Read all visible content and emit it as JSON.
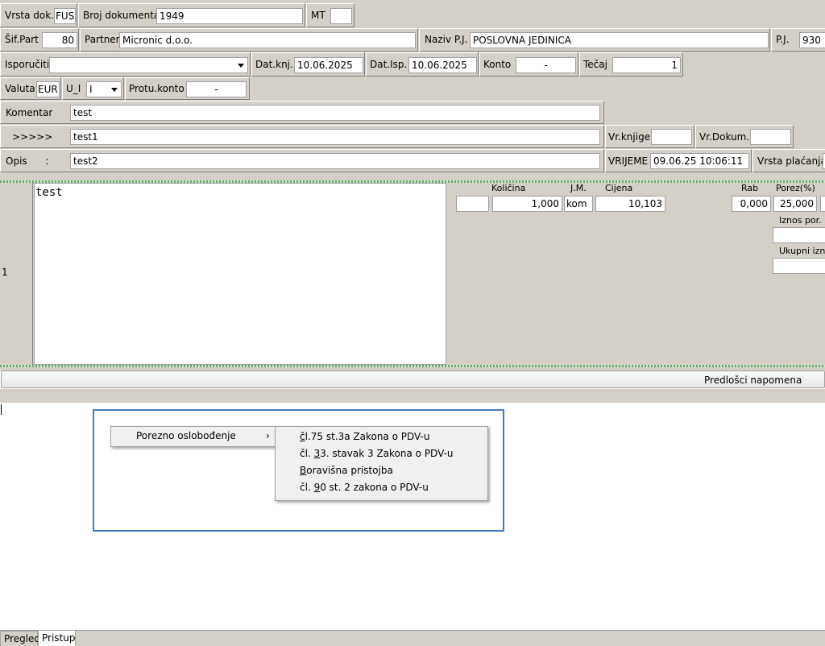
{
  "header": {
    "vrsta_dok_label": "Vrsta dok.",
    "vrsta_dok_value": "FUS",
    "broj_dok_label": "Broj dokumenta",
    "broj_dok_value": "1949",
    "mt_label": "MT",
    "mt_value": "",
    "sif_part_label": "Šif.Part",
    "sif_part_value": "80",
    "partner_label": "Partner",
    "partner_value": "Micronic d.o.o.",
    "naziv_pj_label": "Naziv P.J.",
    "naziv_pj_value": "POSLOVNA JEDINICA",
    "pj_label": "P.J.",
    "pj_value": "930",
    "isporuciti_label": "Isporučiti",
    "isporuciti_value": "",
    "dat_knj_label": "Dat.knj.",
    "dat_knj_value": "10.06.2025",
    "dat_isp_label": "Dat.Isp.",
    "dat_isp_value": "10.06.2025",
    "konto_label": "Konto",
    "konto_value": "-",
    "tecaj_label": "Tečaj",
    "tecaj_value": "1",
    "valuta_label": "Valuta",
    "valuta_value": "EUR",
    "u_i_label": "U_I",
    "u_i_value": "I",
    "protu_konto_label": "Protu.konto",
    "protu_konto_value": "-",
    "komentar_label": "Komentar",
    "komentar_value": "test",
    "arrows_label": ">>>>>",
    "arrows_value": "test1",
    "vr_knjige_label": "Vr.knjige",
    "vr_knjige_value": "",
    "vr_dokum_label": "Vr.Dokum.",
    "vr_dokum_value": "",
    "opis_label": "Opis      :",
    "opis_value": "test2",
    "vrijeme_label": "VRIJEME",
    "vrijeme_value": "09.06.25 10:06:11",
    "vrsta_placanja_label": "Vrsta plaćanja"
  },
  "item": {
    "row_number": "1",
    "description": "test",
    "kolicina_label": "Količina",
    "kolicina_value": "1,000",
    "jm_label": "J.M.",
    "jm_value": "kom",
    "cijena_label": "Cijena",
    "cijena_value": "10,103",
    "rab_label": "Rab",
    "rab_value": "0,000",
    "porez_label": "Porez(%)",
    "porez_value": "25,000",
    "iznos_por_label": "Iznos por.",
    "ukupni_iznos_label": "Ukupni iznos"
  },
  "predlosci_button": "Predlošci napomena",
  "context_menu": {
    "item": "Porezno oslobođenje",
    "submenu": [
      {
        "pre": "",
        "ul": "č",
        "post": "l.75 st.3a Zakona o PDV-u"
      },
      {
        "pre": "čl. ",
        "ul": "3",
        "post": "3. stavak 3 Zakona o PDV-u"
      },
      {
        "pre": "",
        "ul": "B",
        "post": "oravišna pristojba"
      },
      {
        "pre": "čl. ",
        "ul": "9",
        "post": "0 st. 2 zakona o PDV-u"
      }
    ]
  },
  "tabs": [
    "Pregled",
    "Pristup"
  ]
}
